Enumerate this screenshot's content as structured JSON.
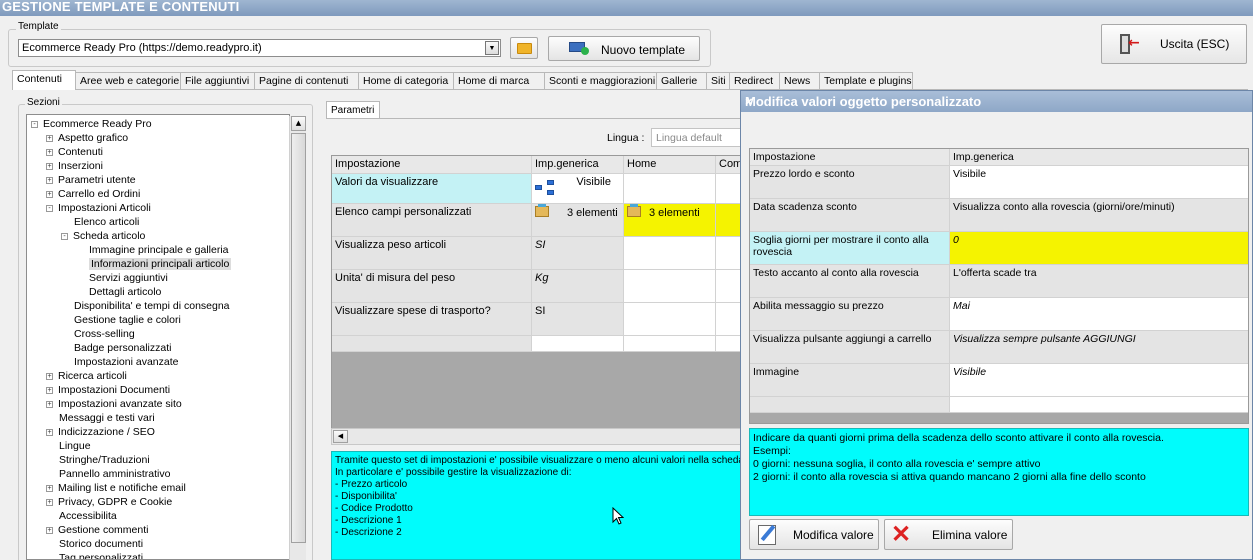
{
  "window_title": "GESTIONE TEMPLATE E CONTENUTI",
  "template": {
    "group_label": "Template",
    "selected": "Ecommerce Ready Pro (https://demo.readypro.it)",
    "new_button": "Nuovo template",
    "exit_button": "Uscita (ESC)"
  },
  "tabs": [
    {
      "label": "Contenuti",
      "active": true
    },
    {
      "label": "Aree web e categorie"
    },
    {
      "label": "File aggiuntivi"
    },
    {
      "label": "Pagine di contenuti"
    },
    {
      "label": "Home di categoria"
    },
    {
      "label": "Home di marca"
    },
    {
      "label": "Sconti e maggiorazioni"
    },
    {
      "label": "Gallerie"
    },
    {
      "label": "Siti"
    },
    {
      "label": "Redirect"
    },
    {
      "label": "News"
    },
    {
      "label": "Template e plugins"
    }
  ],
  "sections": {
    "label": "Sezioni",
    "tree": [
      {
        "label": "Ecommerce Ready Pro",
        "level": 0,
        "exp": "-"
      },
      {
        "label": "Aspetto grafico",
        "level": 1,
        "exp": "+"
      },
      {
        "label": "Contenuti",
        "level": 1,
        "exp": "+"
      },
      {
        "label": "Inserzioni",
        "level": 1,
        "exp": "+"
      },
      {
        "label": "Parametri utente",
        "level": 1,
        "exp": "+"
      },
      {
        "label": "Carrello ed Ordini",
        "level": 1,
        "exp": "+"
      },
      {
        "label": "Impostazioni Articoli",
        "level": 1,
        "exp": "-"
      },
      {
        "label": "Elenco articoli",
        "level": 2,
        "exp": ""
      },
      {
        "label": "Scheda articolo",
        "level": 2,
        "exp": "-"
      },
      {
        "label": "Immagine principale e galleria",
        "level": 3,
        "exp": ""
      },
      {
        "label": "Informazioni principali articolo",
        "level": 3,
        "exp": "",
        "selected": true
      },
      {
        "label": "Servizi aggiuntivi",
        "level": 3,
        "exp": ""
      },
      {
        "label": "Dettagli articolo",
        "level": 3,
        "exp": ""
      },
      {
        "label": "Disponibilita' e tempi di consegna",
        "level": 2,
        "exp": ""
      },
      {
        "label": "Gestione taglie e colori",
        "level": 2,
        "exp": ""
      },
      {
        "label": "Cross-selling",
        "level": 2,
        "exp": ""
      },
      {
        "label": "Badge personalizzati",
        "level": 2,
        "exp": ""
      },
      {
        "label": "Impostazioni avanzate",
        "level": 2,
        "exp": ""
      },
      {
        "label": "Ricerca articoli",
        "level": 1,
        "exp": "+"
      },
      {
        "label": "Impostazioni Documenti",
        "level": 1,
        "exp": "+"
      },
      {
        "label": "Impostazioni avanzate sito",
        "level": 1,
        "exp": "+"
      },
      {
        "label": "Messaggi e testi vari",
        "level": 1,
        "exp": ""
      },
      {
        "label": "Indicizzazione / SEO",
        "level": 1,
        "exp": "+"
      },
      {
        "label": "Lingue",
        "level": 1,
        "exp": ""
      },
      {
        "label": "Stringhe/Traduzioni",
        "level": 1,
        "exp": ""
      },
      {
        "label": "Pannello amministrativo",
        "level": 1,
        "exp": ""
      },
      {
        "label": "Mailing list e notifiche email",
        "level": 1,
        "exp": "+"
      },
      {
        "label": "Privacy, GDPR e Cookie",
        "level": 1,
        "exp": "+"
      },
      {
        "label": "Accessibilita",
        "level": 1,
        "exp": ""
      },
      {
        "label": "Gestione commenti",
        "level": 1,
        "exp": "+"
      },
      {
        "label": "Storico documenti",
        "level": 1,
        "exp": ""
      },
      {
        "label": "Tag personalizzati",
        "level": 1,
        "exp": ""
      }
    ]
  },
  "params": {
    "tab_label": "Parametri",
    "lingua_label": "Lingua :",
    "lingua_placeholder": "Lingua default",
    "headers": [
      "Impostazione",
      "Imp.generica",
      "Home",
      "Com"
    ],
    "rows": [
      {
        "name": "Valori da visualizzare",
        "generic": "Visibile",
        "home": "",
        "com": ""
      },
      {
        "name": "Elenco campi personalizzati",
        "generic": "3 elementi",
        "home": "3 elementi",
        "com": ""
      },
      {
        "name": "Visualizza peso articoli",
        "generic": "SI",
        "home": "",
        "com": ""
      },
      {
        "name": "Unita' di misura del peso",
        "generic": "Kg",
        "home": "",
        "com": ""
      },
      {
        "name": "Visualizzare spese di trasporto?",
        "generic": "SI",
        "home": "",
        "com": ""
      }
    ],
    "description": "Tramite questo set di impostazioni e' possibile visualizzare o meno alcuni valori nella scheda a\nIn particolare e' possibile gestire la visualizzazione di:\n- Prezzo articolo\n- Disponibilita'\n- Codice Prodotto\n- Descrizione 1\n- Descrizione 2"
  },
  "modal": {
    "title": "Modifica valori oggetto personalizzato",
    "close_glyph": "×",
    "headers": [
      "Impostazione",
      "Imp.generica"
    ],
    "rows": [
      {
        "name": "Prezzo lordo e sconto",
        "value": "Visibile"
      },
      {
        "name": "Data scadenza sconto",
        "value": "Visualizza conto alla rovescia (giorni/ore/minuti)"
      },
      {
        "name": "Soglia giorni per mostrare il conto alla rovescia",
        "value": "0"
      },
      {
        "name": "Testo accanto al conto alla rovescia",
        "value": "L'offerta scade tra"
      },
      {
        "name": "Abilita messaggio su prezzo",
        "value": "Mai"
      },
      {
        "name": "Visualizza pulsante aggiungi a carrello",
        "value": "Visualizza sempre pulsante AGGIUNGI"
      },
      {
        "name": "Immagine",
        "value": "Visibile"
      }
    ],
    "description": "Indicare da quanti giorni prima della scadenza dello sconto attivare il conto alla rovescia.\nEsempi:\n0 giorni: nessuna soglia, il conto alla rovescia e' sempre attivo\n2 giorni: il conto alla rovescia si attiva quando mancano 2 giorni alla fine dello sconto",
    "edit_button": "Modifica valore",
    "delete_button": "Elimina valore"
  },
  "colors": {
    "highlight_cyan": "#00fcfc",
    "highlight_yellow": "#f5f300",
    "title_bar": "#8ea7c7"
  }
}
